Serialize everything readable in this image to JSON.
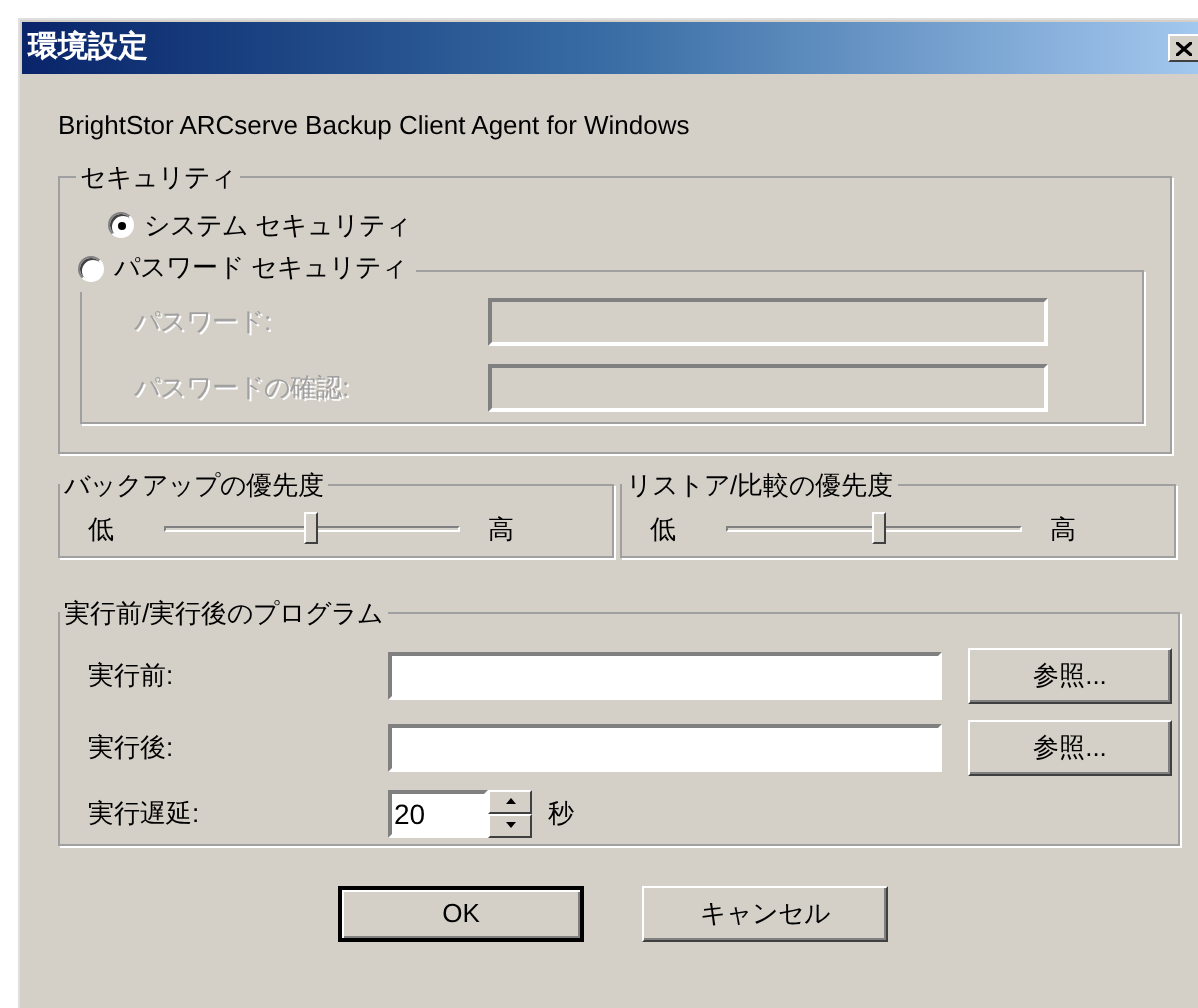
{
  "window": {
    "title": "環境設定"
  },
  "product": "BrightStor ARCserve Backup Client Agent for Windows",
  "security": {
    "title": "セキュリティ",
    "options": [
      {
        "label": "システム セキュリティ",
        "selected": true
      },
      {
        "label": "パスワード セキュリティ",
        "selected": false
      }
    ],
    "fields": [
      {
        "label": "パスワード:",
        "disabled": true
      },
      {
        "label": "パスワードの確認:",
        "disabled": true
      }
    ]
  },
  "priorities": [
    {
      "title": "バックアップの優先度",
      "low": "低",
      "high": "高",
      "level": 0.5
    },
    {
      "title": "リストア/比較の優先度",
      "low": "低",
      "high": "高",
      "level": 0.52
    }
  ],
  "programs": {
    "title": "実行前/実行後のプログラム",
    "rows": [
      {
        "label": "実行前:",
        "button": "参照..."
      },
      {
        "label": "実行後:",
        "button": "参照..."
      }
    ],
    "delay": {
      "label": "実行遅延:",
      "value": "20",
      "unit": "秒"
    }
  },
  "buttons": [
    {
      "label": "OK",
      "default": true
    },
    {
      "label": "キャンセル",
      "default": false
    }
  ]
}
